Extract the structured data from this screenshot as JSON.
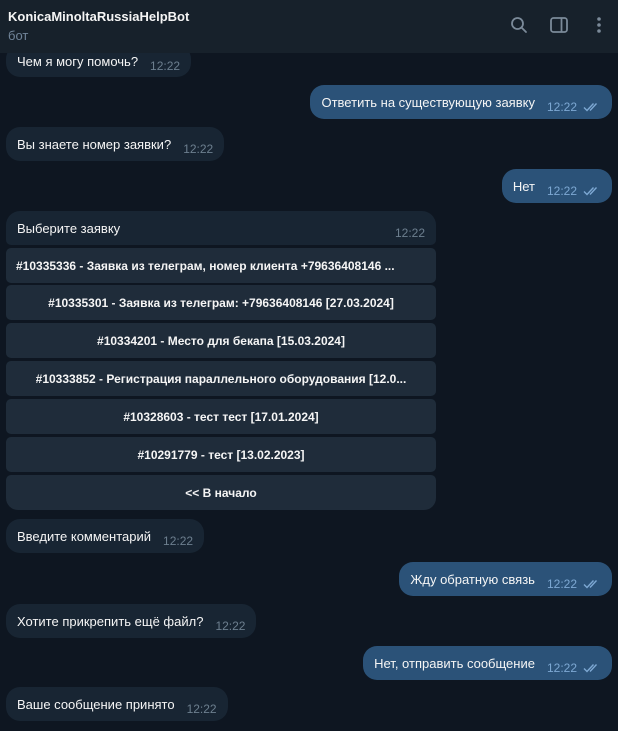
{
  "header": {
    "title": "KonicaMinoltaRussiaHelpBot",
    "subtitle": "бот",
    "icons": [
      "search-icon",
      "sidebar-toggle-icon",
      "more-vertical-icon"
    ]
  },
  "messages": [
    {
      "from": "bot",
      "text": "Чем я могу помочь?",
      "time": "12:22"
    },
    {
      "from": "user",
      "text": "Ответить на существующую заявку",
      "time": "12:22",
      "status": "read"
    },
    {
      "from": "bot",
      "text": "Вы знаете номер заявки?",
      "time": "12:22"
    },
    {
      "from": "user",
      "text": "Нет",
      "time": "12:22",
      "status": "read"
    },
    {
      "from": "bot",
      "text": "Выберите заявку",
      "time": "12:22"
    },
    {
      "from": "bot",
      "text": "Введите комментарий",
      "time": "12:22"
    },
    {
      "from": "user",
      "text": "Жду обратную связь",
      "time": "12:22",
      "status": "read"
    },
    {
      "from": "bot",
      "text": "Хотите прикрепить ещё файл?",
      "time": "12:22"
    },
    {
      "from": "user",
      "text": "Нет, отправить сообщение",
      "time": "12:22",
      "status": "read"
    },
    {
      "from": "bot",
      "text": "Ваше сообщение принято",
      "time": "12:22"
    }
  ],
  "keyboard": [
    "#10335336 - Заявка из телеграм, номер клиента +79636408146 ...",
    "#10335301 - Заявка из телеграм: +79636408146 [27.03.2024]",
    "#10334201 - Место для бекапа [15.03.2024]",
    "#10333852 - Регистрация параллельного оборудования [12.0...",
    "#10328603 - тест тест [17.01.2024]",
    "#10291779 - тест [13.02.2023]",
    "<< В начало"
  ],
  "colors": {
    "background": "#0e1621",
    "header": "#17212b",
    "incoming_bubble": "#182533",
    "outgoing_bubble": "#2b5278",
    "keyboard_button": "#1f2c3a"
  }
}
